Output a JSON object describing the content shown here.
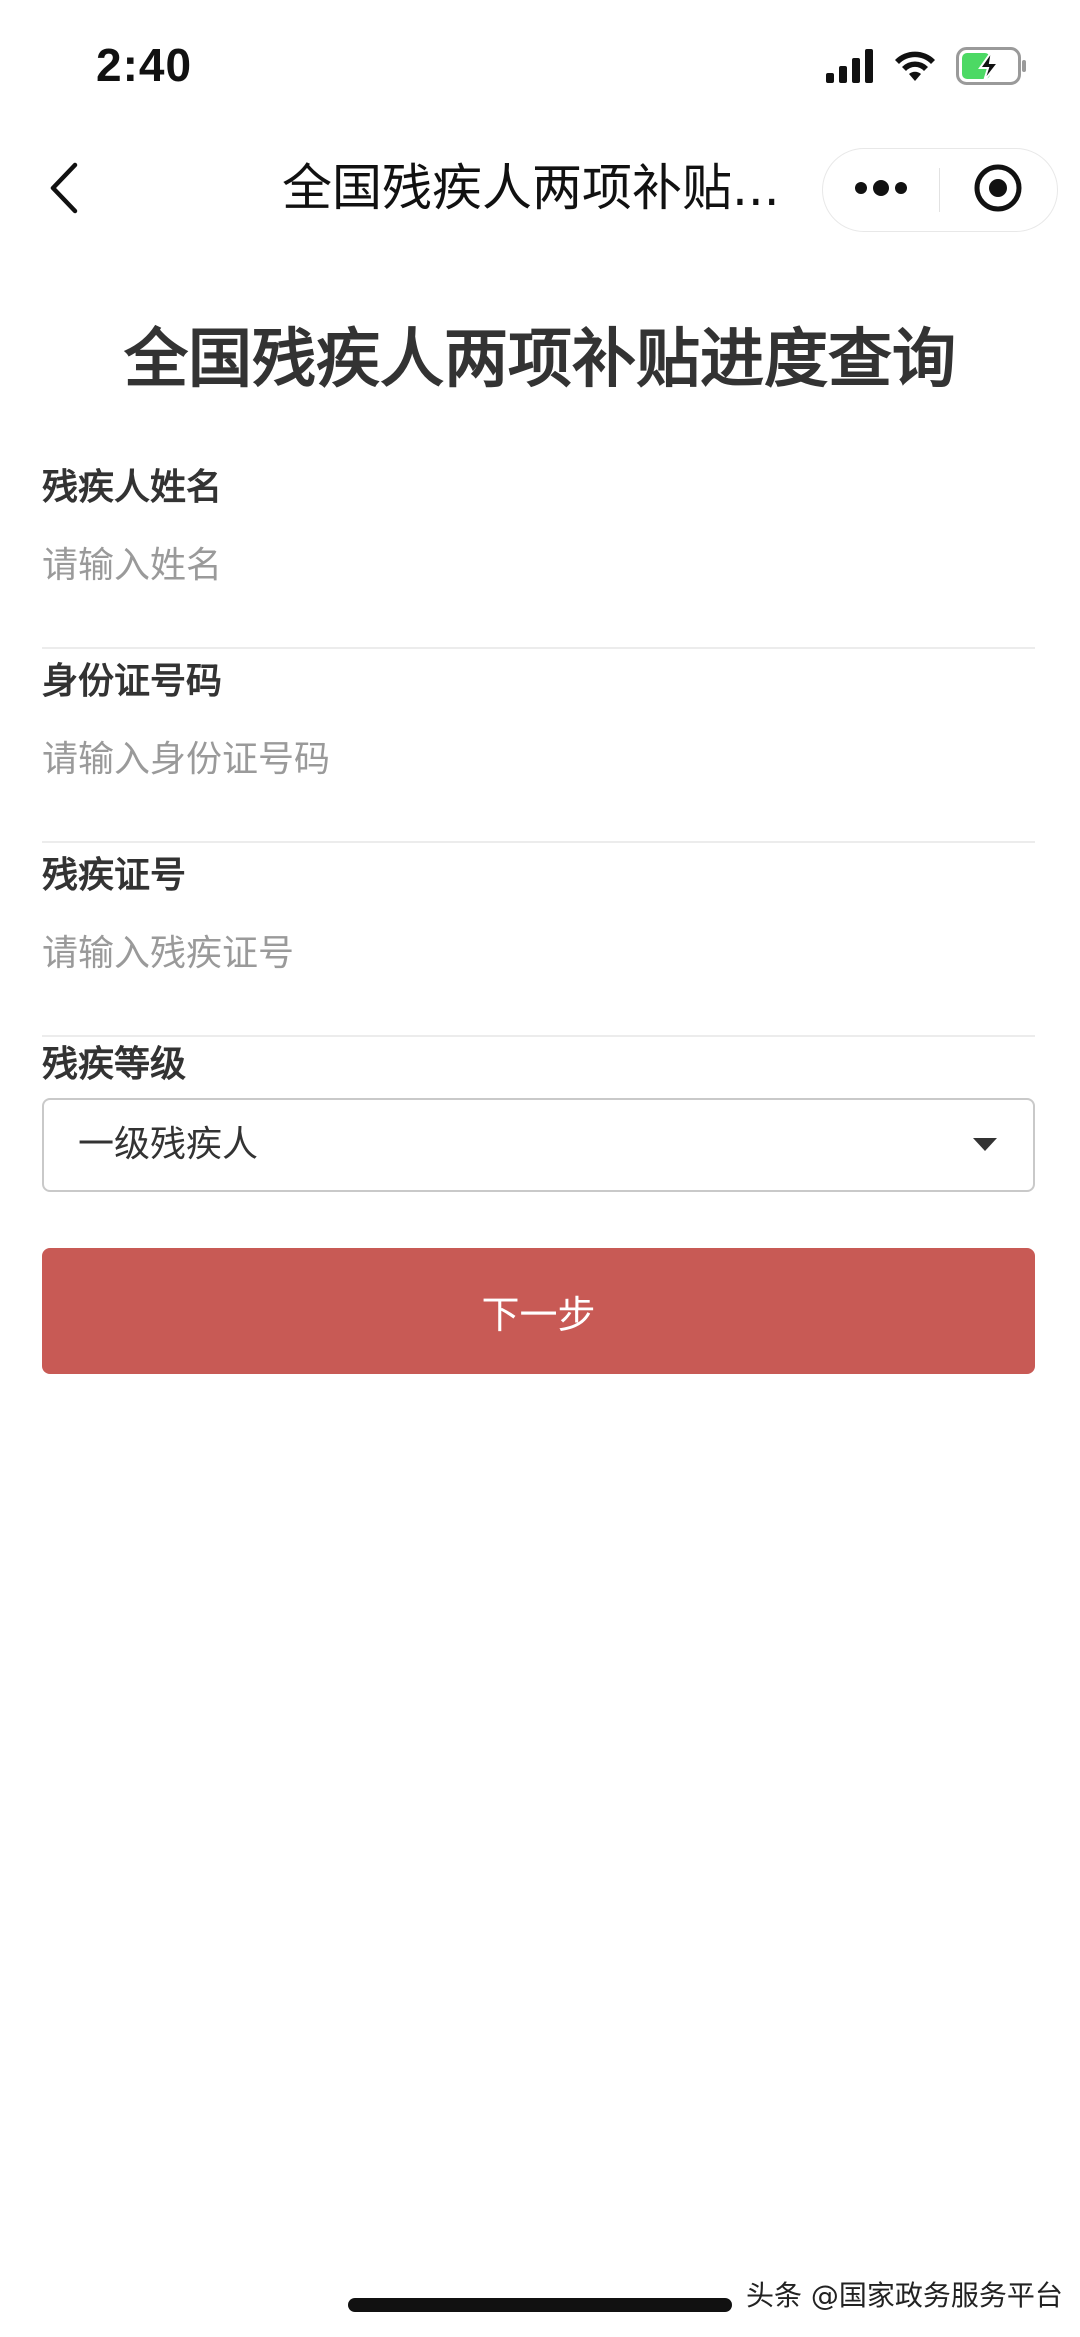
{
  "status_bar": {
    "time": "2:40",
    "icons": [
      "cellular-signal-icon",
      "wifi-icon",
      "battery-charging-icon"
    ],
    "battery_color": "#4cd964"
  },
  "nav": {
    "title": "全国残疾人两项补贴...",
    "icons": [
      "back-chevron-icon",
      "more-dots-icon",
      "close-target-icon"
    ]
  },
  "page": {
    "heading": "全国残疾人两项补贴进度查询"
  },
  "form": {
    "name": {
      "label": "残疾人姓名",
      "value": "",
      "placeholder": "请输入姓名"
    },
    "id_number": {
      "label": "身份证号码",
      "value": "",
      "placeholder": "请输入身份证号码"
    },
    "disability_cert": {
      "label": "残疾证号",
      "value": "",
      "placeholder": "请输入残疾证号"
    },
    "disability_level": {
      "label": "残疾等级",
      "selected": "一级残疾人"
    },
    "next_label": "下一步"
  },
  "colors": {
    "button": "#c85a55",
    "text": "#333333",
    "placeholder": "#9a9a9a"
  },
  "watermark": "头条 @国家政务服务平台"
}
